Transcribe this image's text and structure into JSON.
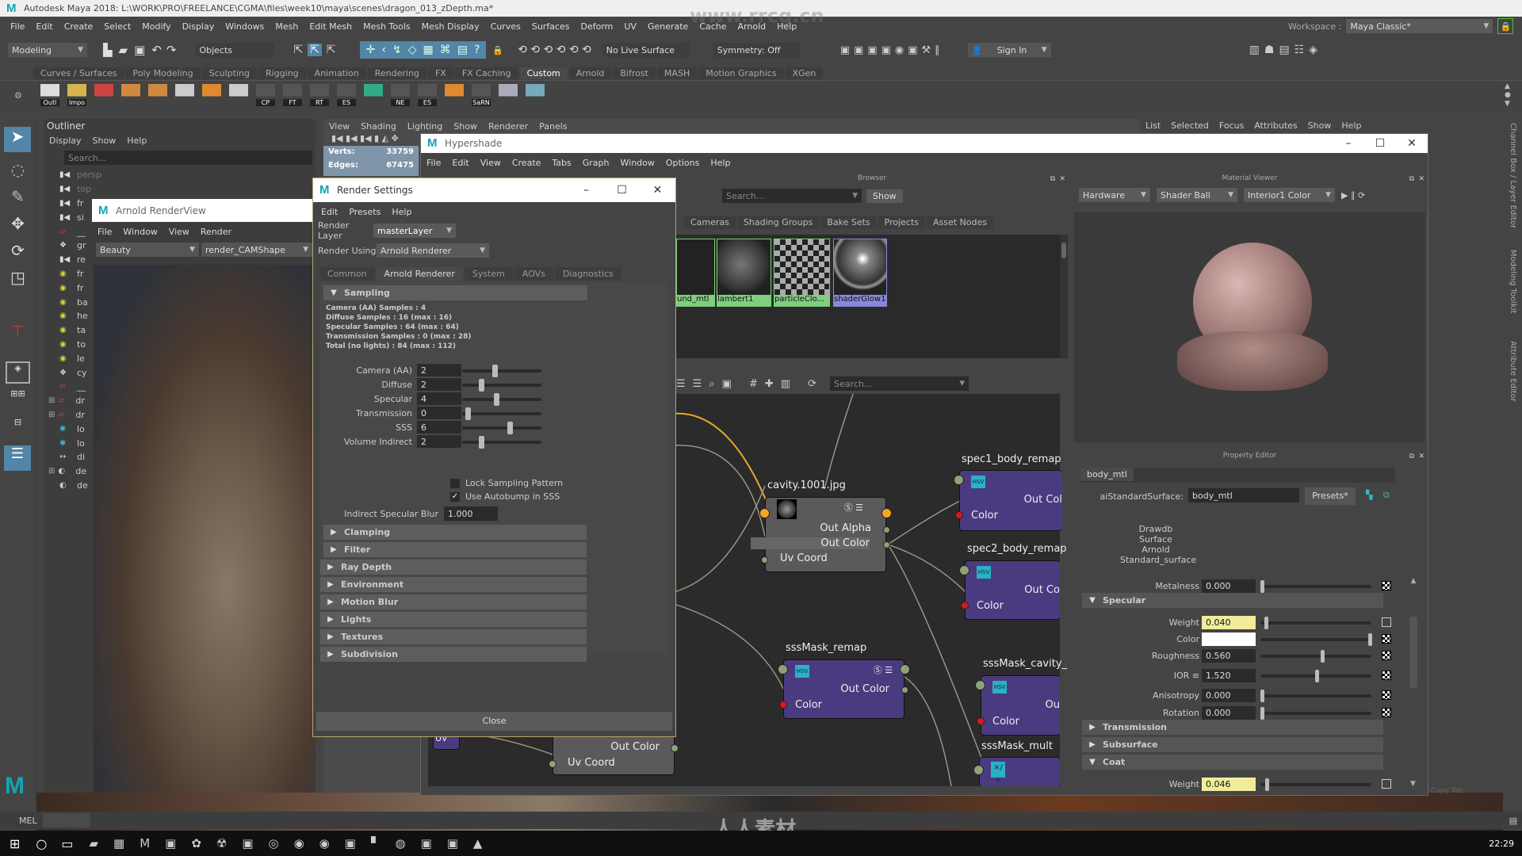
{
  "app": {
    "title": "Autodesk Maya 2018: L:\\WORK\\PRO\\FREELANCE\\CGMA\\files\\week10\\maya\\scenes\\dragon_013_zDepth.ma*",
    "menu": [
      "File",
      "Edit",
      "Create",
      "Select",
      "Modify",
      "Display",
      "Windows",
      "Mesh",
      "Edit Mesh",
      "Mesh Tools",
      "Mesh Display",
      "Curves",
      "Surfaces",
      "Deform",
      "UV",
      "Generate",
      "Cache",
      "Arnold",
      "Help"
    ],
    "workspace_label": "Workspace :",
    "workspace_value": "Maya Classic*",
    "watermark": "www.rrcg.cn",
    "watermark_logo": "人人素材"
  },
  "status_line": {
    "mode": "Modeling",
    "objects": "Objects",
    "live_surface": "No Live Surface",
    "symmetry": "Symmetry: Off",
    "sign_in": "Sign In"
  },
  "shelf": {
    "tabs": [
      "Curves / Surfaces",
      "Poly Modeling",
      "Sculpting",
      "Rigging",
      "Animation",
      "Rendering",
      "FX",
      "FX Caching",
      "Custom",
      "Arnold",
      "Bifrost",
      "MASH",
      "Motion Graphics",
      "XGen"
    ],
    "active_tab": "Custom",
    "icons": [
      "Outl",
      "Impo",
      "",
      "",
      "",
      "",
      "",
      "",
      "CP",
      "FT",
      "RT",
      "ES",
      "",
      "NE",
      "ES",
      "",
      "SaRN",
      "",
      ""
    ]
  },
  "outliner": {
    "title": "Outliner",
    "menu": [
      "Display",
      "Show",
      "Help"
    ],
    "search_placeholder": "Search...",
    "items": [
      {
        "icon": "camera",
        "text": "persp"
      },
      {
        "icon": "camera",
        "text": "top"
      },
      {
        "icon": "camera",
        "text": "fr"
      },
      {
        "icon": "camera",
        "text": "si"
      },
      {
        "icon": "set",
        "text": "__"
      },
      {
        "icon": "group",
        "text": "gr"
      },
      {
        "icon": "camera",
        "text": "re"
      },
      {
        "icon": "light",
        "text": "fr"
      },
      {
        "icon": "light",
        "text": "fr"
      },
      {
        "icon": "light",
        "text": "ba"
      },
      {
        "icon": "light",
        "text": "he"
      },
      {
        "icon": "light",
        "text": "ta"
      },
      {
        "icon": "light",
        "text": "to"
      },
      {
        "icon": "light",
        "text": "le"
      },
      {
        "icon": "group",
        "text": "cy"
      },
      {
        "icon": "set",
        "text": "__"
      },
      {
        "icon": "set",
        "text": "dr",
        "expand": true
      },
      {
        "icon": "set",
        "text": "dr",
        "expand": true
      },
      {
        "icon": "locator",
        "text": "lo"
      },
      {
        "icon": "locator",
        "text": "lo"
      },
      {
        "icon": "dimension",
        "text": "di"
      },
      {
        "icon": "deformer",
        "text": "de",
        "expand": true
      },
      {
        "icon": "deformer",
        "text": "de"
      }
    ]
  },
  "renderview": {
    "title": "Arnold RenderView",
    "menu": [
      "File",
      "Window",
      "View",
      "Render"
    ],
    "aov": "Beauty",
    "camera": "render_CAMShape"
  },
  "viewport": {
    "menu": [
      "View",
      "Shading",
      "Lighting",
      "Show",
      "Renderer",
      "Panels"
    ],
    "hud": [
      {
        "label": "Verts:",
        "value": "33759"
      },
      {
        "label": "Edges:",
        "value": "67475"
      }
    ]
  },
  "attribute_editor": {
    "menu": [
      "List",
      "Selected",
      "Focus",
      "Attributes",
      "Show",
      "Help"
    ]
  },
  "render_settings": {
    "title": "Render Settings",
    "menu": [
      "Edit",
      "Presets",
      "Help"
    ],
    "render_layer_label": "Render Layer",
    "render_layer": "masterLayer",
    "render_using_label": "Render Using",
    "render_using": "Arnold Renderer",
    "tabs": [
      "Common",
      "Arnold Renderer",
      "System",
      "AOVs",
      "Diagnostics"
    ],
    "active_tab": "Arnold Renderer",
    "sampling_title": "Sampling",
    "info": [
      "Camera (AA) Samples : 4",
      "Diffuse Samples : 16 (max : 16)",
      "Specular Samples : 64 (max : 64)",
      "Transmission Samples : 0 (max : 28)",
      "Total (no lights) : 84 (max : 112)"
    ],
    "rows": [
      {
        "label": "Camera (AA)",
        "value": "2",
        "slider": 0.4
      },
      {
        "label": "Diffuse",
        "value": "2",
        "slider": 0.22
      },
      {
        "label": "Specular",
        "value": "4",
        "slider": 0.42
      },
      {
        "label": "Transmission",
        "value": "0",
        "slider": 0.04
      },
      {
        "label": "SSS",
        "value": "6",
        "slider": 0.6
      },
      {
        "label": "Volume Indirect",
        "value": "2",
        "slider": 0.22
      }
    ],
    "lock_sampling": {
      "label": "Lock Sampling Pattern",
      "checked": false
    },
    "autobump": {
      "label": "Use Autobump in SSS",
      "checked": true
    },
    "indirect_blur_label": "Indirect Specular Blur",
    "indirect_blur": "1.000",
    "sections": [
      "Clamping",
      "Filter",
      "Ray Depth",
      "Environment",
      "Motion Blur",
      "Lights",
      "Textures",
      "Subdivision"
    ],
    "close": "Close"
  },
  "hypershade": {
    "title": "Hypershade",
    "menu": [
      "File",
      "Edit",
      "View",
      "Create",
      "Tabs",
      "Graph",
      "Window",
      "Options",
      "Help"
    ],
    "browser": {
      "title": "Browser",
      "search_placeholder": "Search...",
      "show": "Show",
      "tabs": [
        "Cameras",
        "Shading Groups",
        "Bake Sets",
        "Projects",
        "Asset Nodes"
      ],
      "swatches": [
        {
          "name": "und_mtl",
          "color": "#7ecf7e"
        },
        {
          "name": "lambert1",
          "color": "#7ecf7e"
        },
        {
          "name": "particleClo...",
          "color": "#7ecf7e"
        },
        {
          "name": "shaderGlow1",
          "color": "#8888dd"
        }
      ]
    },
    "graph_search_placeholder": "Search...",
    "nodes": {
      "cavity": {
        "title": "cavity.1001.jpg",
        "out_alpha": "Out Alpha",
        "out_color": "Out Color",
        "uv": "Uv Coord"
      },
      "spec1": {
        "title": "spec1_body_remap",
        "out": "Out Col",
        "in": "Color"
      },
      "spec2": {
        "title": "spec2_body_remap",
        "out": "Out Co",
        "in": "Color"
      },
      "sss_remap": {
        "title": "sssMask_remap",
        "out": "Out Color",
        "in": "Color"
      },
      "sss_cavity": {
        "title": "sssMask_cavity_",
        "out": "Ou",
        "in": "Color"
      },
      "sss_mult": {
        "title": "sssMask_mult"
      },
      "bottom": {
        "out": "Out Color",
        "uv": "Uv Coord"
      },
      "uv_node": {
        "label": "UV"
      }
    },
    "material_viewer": {
      "title": "Material Viewer",
      "renderer": "Hardware",
      "geometry": "Shader Ball",
      "environment": "Interior1 Color"
    },
    "property_editor": {
      "title": "Property Editor",
      "tab": "body_mtl",
      "type_label": "aiStandardSurface:",
      "node_name": "body_mtl",
      "presets": "Presets*",
      "classification": [
        "Drawdb",
        "Surface",
        "Arnold",
        "Standard_surface"
      ],
      "metalness": {
        "label": "Metalness",
        "value": "0.000",
        "slider": 0.0
      },
      "specular_title": "Specular",
      "specular": [
        {
          "label": "Weight",
          "value": "0.040",
          "slider": 0.04,
          "keyed": true
        },
        {
          "label": "Color",
          "value": "",
          "slider": 1.0,
          "swatch": "#ffffff"
        },
        {
          "label": "Roughness",
          "value": "0.560",
          "slider": 0.56
        },
        {
          "label": "IOR ≡",
          "value": "1.520",
          "slider": 0.51
        },
        {
          "label": "Anisotropy",
          "value": "0.000",
          "slider": 0.0
        },
        {
          "label": "Rotation",
          "value": "0.000",
          "slider": 0.0
        }
      ],
      "collapsed": [
        "Transmission",
        "Subsurface"
      ],
      "coat_title": "Coat",
      "coat_weight": {
        "label": "Weight",
        "value": "0.046",
        "slider": 0.046,
        "keyed": true
      },
      "copy_tab": "Copy Tab"
    }
  },
  "side_tabs": [
    "Channel Box / Layer Editor",
    "Modeling Toolkit",
    "Attribute Editor"
  ],
  "command_line": {
    "lang": "MEL"
  },
  "taskbar": {
    "clock": "22:29"
  },
  "colors": {
    "accent": "#5285a6",
    "node_purple": "#4a3b80",
    "key_yellow": "#f0ec9a",
    "maya_teal": "#15a3b5"
  }
}
